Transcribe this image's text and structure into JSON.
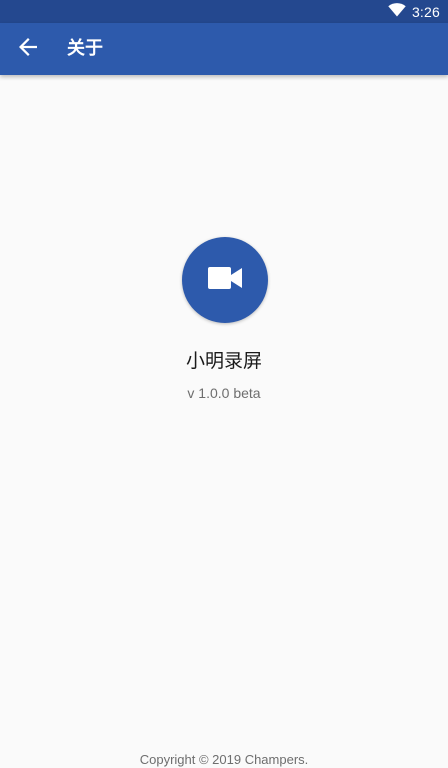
{
  "status_bar": {
    "time": "3:26",
    "icons": [
      "wifi-icon"
    ]
  },
  "toolbar": {
    "title": "关于",
    "back_icon": "arrow-back-icon"
  },
  "app": {
    "icon": "videocam-icon",
    "name": "小明录屏",
    "version": "v 1.0.0 beta"
  },
  "footer": {
    "copyright": "Copyright © 2019 Champers."
  },
  "colors": {
    "status_bar": "#24488f",
    "toolbar": "#2d5aac",
    "accent": "#2d5aac",
    "background": "#fafafa",
    "secondary_text": "#6e6e6e"
  }
}
